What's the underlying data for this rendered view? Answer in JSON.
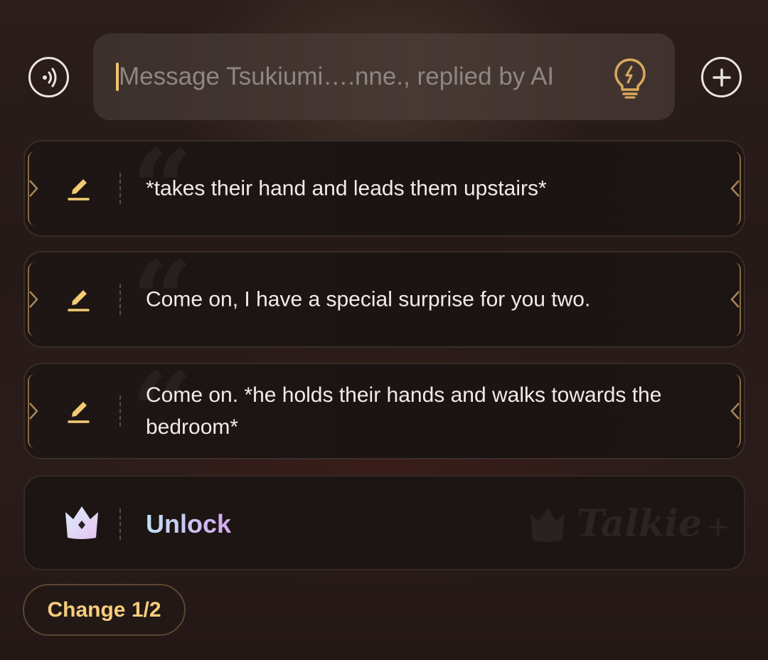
{
  "input": {
    "placeholder": "Message Tsukiumi….nne., replied by AI"
  },
  "suggestions": [
    {
      "text": "*takes their hand and leads them upstairs*"
    },
    {
      "text": "Come on, I have a special surprise for you two."
    },
    {
      "text": "Come on. *he holds their hands and walks towards the bedroom*"
    }
  ],
  "unlock": {
    "label": "Unlock",
    "brand": "Talkie"
  },
  "change_button": {
    "label": "Change 1/2"
  },
  "icons": {
    "voice": "voice-wave-icon",
    "bulb": "lightbulb-icon",
    "add": "plus-icon",
    "edit": "pencil-icon",
    "crown": "crown-icon"
  },
  "colors": {
    "accent_gold": "#f6cd7d",
    "caret": "#f0c46a",
    "unlock_gradient_start": "#bfe0f4",
    "unlock_gradient_end": "#d7a9ef"
  }
}
